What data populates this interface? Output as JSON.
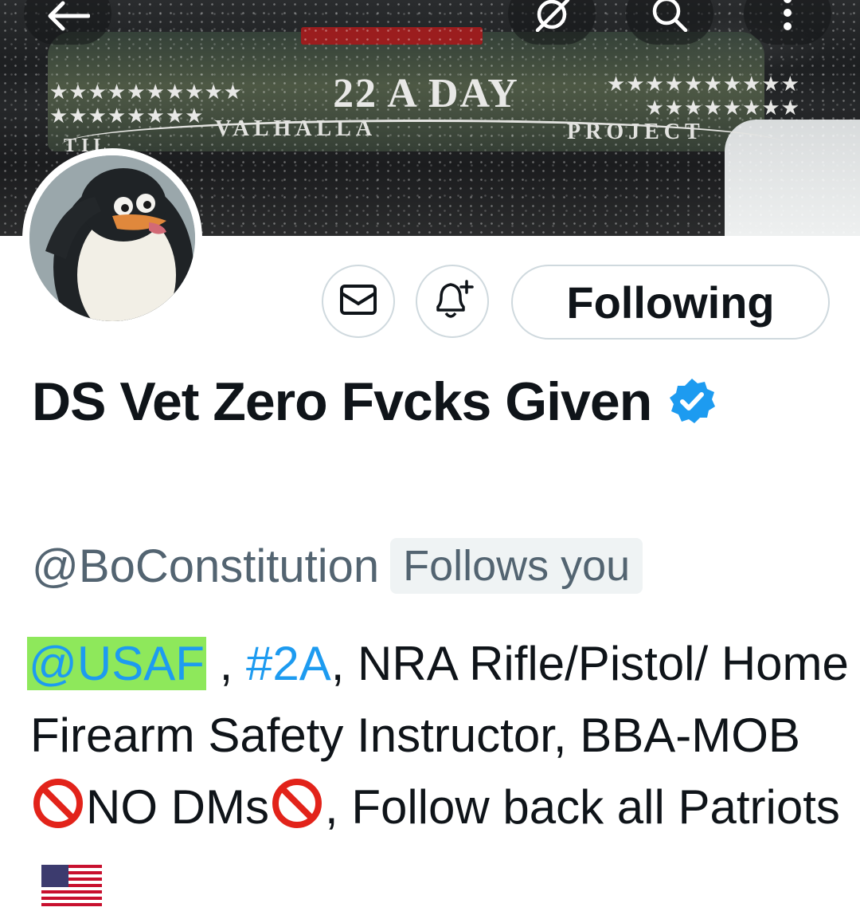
{
  "banner": {
    "decal_title": "22 A DAY",
    "decal_left": "VALHALLA",
    "decal_right": "PROJECT",
    "decal_edge": "TIL"
  },
  "topbar": {
    "icons": [
      "back-arrow-icon",
      "grok-icon",
      "search-icon",
      "more-vertical-icon"
    ]
  },
  "profile": {
    "display_name": "DS Vet Zero Fvcks Given",
    "handle": "@BoConstitution",
    "follows_you": "Follows you",
    "follow_button": "Following",
    "verified_color": "#1d9bf0"
  },
  "bio": {
    "mention": "@USAF",
    "sep1": " , ",
    "hashtag": "#2A",
    "text1": ", NRA Rifle/Pistol/ Home Firearm Safety Instructor, BBA-MOB ",
    "no_dms": "NO DMs",
    "text2": ", Follow back all Patriots",
    "emojis": [
      "prohibited-icon",
      "prohibited-icon",
      "us-flag-icon"
    ]
  },
  "colors": {
    "link": "#1d9bf0",
    "highlight": "#8ee85b",
    "secondary_text": "#536471",
    "border": "#cfd9de"
  }
}
